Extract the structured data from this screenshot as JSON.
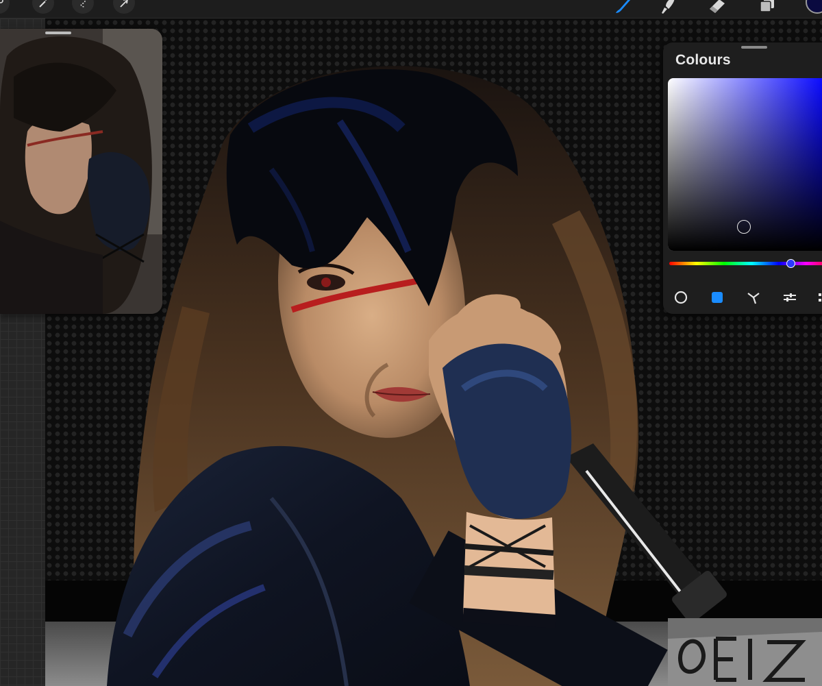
{
  "app": {
    "accent_color": "#1a8cff",
    "current_color": "#0a0a40"
  },
  "toolbar": {
    "left_tools": [
      "wrench-icon",
      "magic-wand-icon",
      "selection-icon",
      "transform-arrow-icon"
    ],
    "right_tools": [
      "brush-icon",
      "smudge-icon",
      "eraser-icon",
      "layers-icon"
    ],
    "active_tool": "brush-icon"
  },
  "reference_window": {
    "visible": true
  },
  "colours_panel": {
    "title": "Colours",
    "hue_fraction": 0.74,
    "saturation_fraction": 0.47,
    "brightness_fraction": 0.14,
    "modes": [
      "disc-mode-icon",
      "classic-mode-icon",
      "harmony-mode-icon",
      "value-mode-icon",
      "palettes-icon"
    ],
    "active_mode": "classic-mode-icon"
  }
}
